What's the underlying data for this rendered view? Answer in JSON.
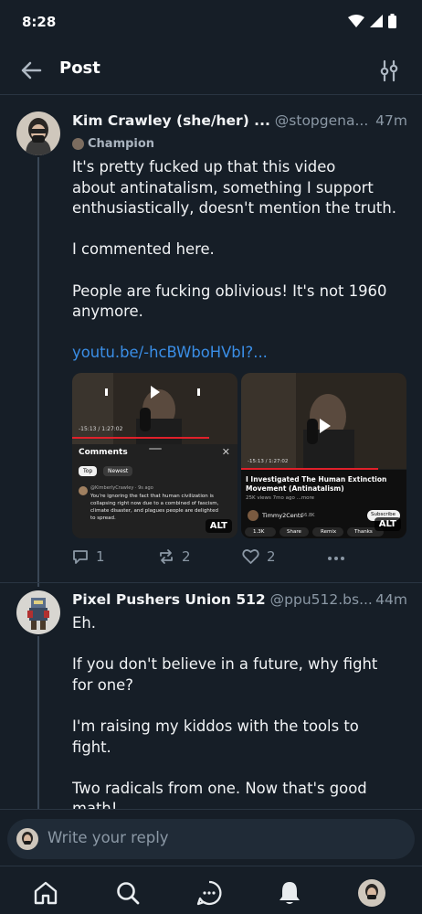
{
  "status": {
    "time": "8:28"
  },
  "appbar": {
    "title": "Post"
  },
  "posts": [
    {
      "author": "Kim Crawley (she/her) ...",
      "handle": "@stopgena...",
      "time": "47m",
      "badge": "Champion",
      "lines": [
        "It's pretty fucked up that this video",
        "about antinatalism, something I support",
        "enthusiastically, doesn't mention the truth.",
        "",
        "I commented here.",
        "",
        "People are fucking oblivious! It's not 1960",
        "anymore."
      ],
      "link": "youtu.be/-hcBWboHVbI?...",
      "media": [
        {
          "time": "-15:13 / 1:27:02",
          "panel_title": "Comments",
          "chips": [
            "Top",
            "Newest"
          ],
          "commenter": "@KimberlyCrawley · 9s ago",
          "comment": "You're ignoring the fact that human civilization is collapsing right now due to a combined of fascism, climate disaster, and plagues people are delighted to spread.",
          "alt": "ALT"
        },
        {
          "time": "-15:13 / 1:27:02",
          "video_title": "I Investigated The Human Extinction Movement (Antinatalism)",
          "meta": "25K views  7mo ago  ...more",
          "channel": "Timmy2Cents",
          "subs": "56.8K",
          "subscribe": "Subscribe",
          "chips": [
            "1.3K",
            "Share",
            "Remix",
            "Thanks"
          ],
          "alt": "ALT"
        }
      ],
      "replies": "1",
      "reposts": "2",
      "likes": "2"
    },
    {
      "author": "Pixel Pushers Union 512",
      "handle": "@ppu512.bs...",
      "time": "44m",
      "lines": [
        "Eh.",
        "",
        "If you don't believe in a future, why fight",
        "for one?",
        "",
        "I'm raising my kiddos with the tools to",
        "fight.",
        "",
        "Two radicals from one. Now that's good",
        "math!"
      ]
    }
  ],
  "reply": {
    "placeholder": "Write your reply"
  },
  "nav": [
    "home-icon",
    "search-icon",
    "chat-icon",
    "notifications-icon",
    "profile-avatar"
  ],
  "colors": {
    "background": "#161e27",
    "link": "#3a8ee6",
    "muted": "#8b98a5"
  }
}
